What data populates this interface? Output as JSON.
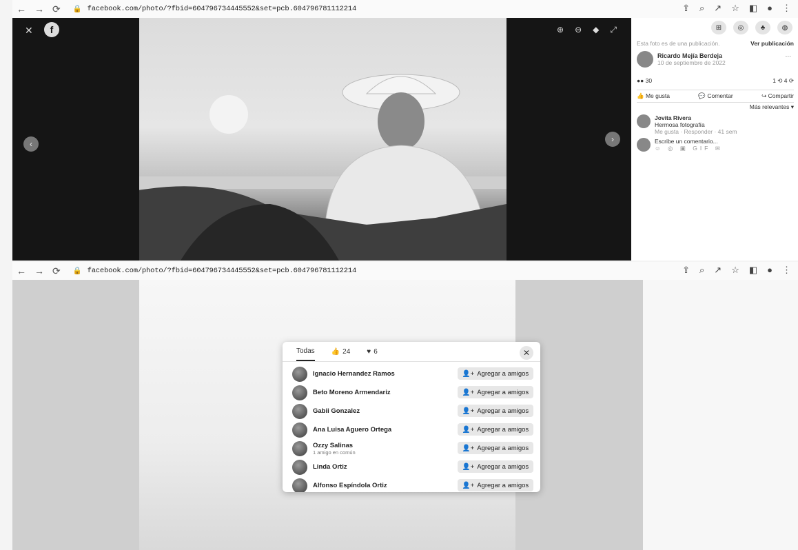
{
  "top": {
    "url": "facebook.com/photo/?fbid=604796734445552&set=pcb.604796781112214",
    "side": {
      "notice": "Esta foto es de una publicación.",
      "view_post": "Ver publicación",
      "author": "Ricardo Mejía Berdeja",
      "date": "10 de septiembre de 2022",
      "reactions_count": "30",
      "comments_shares": "1 ⟲ 4 ⟳",
      "like_label": "Me gusta",
      "comment_label": "Comentar",
      "share_label": "Compartir",
      "relevant_label": "Más relevantes ▾",
      "commenter_name": "Jovita Rivera",
      "comment_text": "Hermosa fotografía",
      "comment_actions": "Me gusta · Responder · 41 sem",
      "write_comment_placeholder": "Escribe un comentario..."
    }
  },
  "bottom": {
    "url": "facebook.com/photo/?fbid=604796734445552&set=pcb.604796781112214",
    "dialog": {
      "tab_all": "Todas",
      "tab_like_count": "24",
      "tab_love_count": "6",
      "add_label": "Agregar a amigos",
      "people": [
        {
          "name": "Ignacio Hernandez Ramos",
          "sub": ""
        },
        {
          "name": "Beto Moreno Armendariz",
          "sub": ""
        },
        {
          "name": "Gabii Gonzalez",
          "sub": ""
        },
        {
          "name": "Ana Luisa Aguero Ortega",
          "sub": ""
        },
        {
          "name": "Ozzy Salinas",
          "sub": "1 amigo en común"
        },
        {
          "name": "Linda Ortiz",
          "sub": ""
        },
        {
          "name": "Alfonso Espíndola Ortiz",
          "sub": ""
        }
      ]
    }
  }
}
